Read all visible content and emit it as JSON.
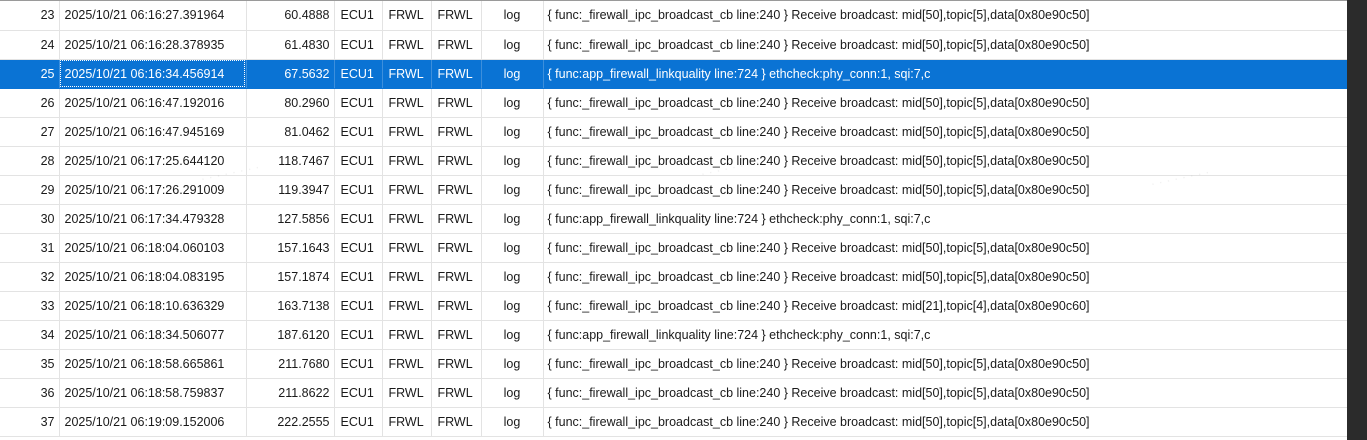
{
  "log_table": {
    "selected_row_index": 2,
    "rows": [
      {
        "index": "23",
        "time": "2025/10/21 06:16:27.391964",
        "timestamp": "60.4888",
        "ecu": "ECU1",
        "apid": "FRWL",
        "ctid": "FRWL",
        "type": "log",
        "payload": "{ func:_firewall_ipc_broadcast_cb line:240 } Receive broadcast: mid[50],topic[5],data[0x80e90c50]"
      },
      {
        "index": "24",
        "time": "2025/10/21 06:16:28.378935",
        "timestamp": "61.4830",
        "ecu": "ECU1",
        "apid": "FRWL",
        "ctid": "FRWL",
        "type": "log",
        "payload": "{ func:_firewall_ipc_broadcast_cb line:240 } Receive broadcast: mid[50],topic[5],data[0x80e90c50]"
      },
      {
        "index": "25",
        "time": "2025/10/21 06:16:34.456914",
        "timestamp": "67.5632",
        "ecu": "ECU1",
        "apid": "FRWL",
        "ctid": "FRWL",
        "type": "log",
        "payload": "{ func:app_firewall_linkquality line:724 } ethcheck:phy_conn:1, sqi:7,c"
      },
      {
        "index": "26",
        "time": "2025/10/21 06:16:47.192016",
        "timestamp": "80.2960",
        "ecu": "ECU1",
        "apid": "FRWL",
        "ctid": "FRWL",
        "type": "log",
        "payload": "{ func:_firewall_ipc_broadcast_cb line:240 } Receive broadcast: mid[50],topic[5],data[0x80e90c50]"
      },
      {
        "index": "27",
        "time": "2025/10/21 06:16:47.945169",
        "timestamp": "81.0462",
        "ecu": "ECU1",
        "apid": "FRWL",
        "ctid": "FRWL",
        "type": "log",
        "payload": "{ func:_firewall_ipc_broadcast_cb line:240 } Receive broadcast: mid[50],topic[5],data[0x80e90c50]"
      },
      {
        "index": "28",
        "time": "2025/10/21 06:17:25.644120",
        "timestamp": "118.7467",
        "ecu": "ECU1",
        "apid": "FRWL",
        "ctid": "FRWL",
        "type": "log",
        "payload": "{ func:_firewall_ipc_broadcast_cb line:240 } Receive broadcast: mid[50],topic[5],data[0x80e90c50]"
      },
      {
        "index": "29",
        "time": "2025/10/21 06:17:26.291009",
        "timestamp": "119.3947",
        "ecu": "ECU1",
        "apid": "FRWL",
        "ctid": "FRWL",
        "type": "log",
        "payload": "{ func:_firewall_ipc_broadcast_cb line:240 } Receive broadcast: mid[50],topic[5],data[0x80e90c50]"
      },
      {
        "index": "30",
        "time": "2025/10/21 06:17:34.479328",
        "timestamp": "127.5856",
        "ecu": "ECU1",
        "apid": "FRWL",
        "ctid": "FRWL",
        "type": "log",
        "payload": "{ func:app_firewall_linkquality line:724 } ethcheck:phy_conn:1, sqi:7,c"
      },
      {
        "index": "31",
        "time": "2025/10/21 06:18:04.060103",
        "timestamp": "157.1643",
        "ecu": "ECU1",
        "apid": "FRWL",
        "ctid": "FRWL",
        "type": "log",
        "payload": "{ func:_firewall_ipc_broadcast_cb line:240 } Receive broadcast: mid[50],topic[5],data[0x80e90c50]"
      },
      {
        "index": "32",
        "time": "2025/10/21 06:18:04.083195",
        "timestamp": "157.1874",
        "ecu": "ECU1",
        "apid": "FRWL",
        "ctid": "FRWL",
        "type": "log",
        "payload": "{ func:_firewall_ipc_broadcast_cb line:240 } Receive broadcast: mid[50],topic[5],data[0x80e90c50]"
      },
      {
        "index": "33",
        "time": "2025/10/21 06:18:10.636329",
        "timestamp": "163.7138",
        "ecu": "ECU1",
        "apid": "FRWL",
        "ctid": "FRWL",
        "type": "log",
        "payload": "{ func:_firewall_ipc_broadcast_cb line:240 } Receive broadcast: mid[21],topic[4],data[0x80e90c60]"
      },
      {
        "index": "34",
        "time": "2025/10/21 06:18:34.506077",
        "timestamp": "187.6120",
        "ecu": "ECU1",
        "apid": "FRWL",
        "ctid": "FRWL",
        "type": "log",
        "payload": "{ func:app_firewall_linkquality line:724 } ethcheck:phy_conn:1, sqi:7,c"
      },
      {
        "index": "35",
        "time": "2025/10/21 06:18:58.665861",
        "timestamp": "211.7680",
        "ecu": "ECU1",
        "apid": "FRWL",
        "ctid": "FRWL",
        "type": "log",
        "payload": "{ func:_firewall_ipc_broadcast_cb line:240 } Receive broadcast: mid[50],topic[5],data[0x80e90c50]"
      },
      {
        "index": "36",
        "time": "2025/10/21 06:18:58.759837",
        "timestamp": "211.8622",
        "ecu": "ECU1",
        "apid": "FRWL",
        "ctid": "FRWL",
        "type": "log",
        "payload": "{ func:_firewall_ipc_broadcast_cb line:240 } Receive broadcast: mid[50],topic[5],data[0x80e90c50]"
      },
      {
        "index": "37",
        "time": "2025/10/21 06:19:09.152006",
        "timestamp": "222.2555",
        "ecu": "ECU1",
        "apid": "FRWL",
        "ctid": "FRWL",
        "type": "log",
        "payload": "{ func:_firewall_ipc_broadcast_cb line:240 } Receive broadcast: mid[50],topic[5],data[0x80e90c50]"
      }
    ]
  },
  "colors": {
    "selection": "#0a73d4",
    "grid_line": "#e3e3e3",
    "background": "#ffffff",
    "outer_frame": "#2b2b2b"
  }
}
